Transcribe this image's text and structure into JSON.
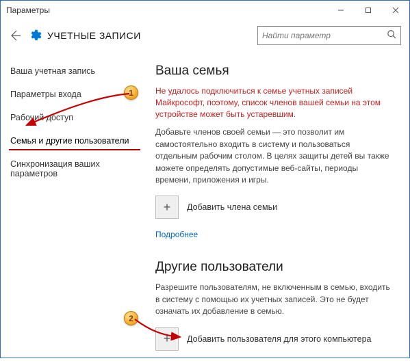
{
  "window": {
    "title": "Параметры"
  },
  "header": {
    "section_title": "УЧЕТНЫЕ ЗАПИСИ",
    "search_placeholder": "Найти параметр"
  },
  "sidebar": {
    "items": [
      {
        "label": "Ваша учетная запись"
      },
      {
        "label": "Параметры входа"
      },
      {
        "label": "Рабочий доступ"
      },
      {
        "label": "Семья и другие пользователи"
      },
      {
        "label": "Синхронизация ваших параметров"
      }
    ],
    "active_index": 3
  },
  "main": {
    "family": {
      "heading": "Ваша семья",
      "error": "Не удалось подключиться к семье учетных записей Майкрософт, поэтому, список членов вашей семьи на этом устройстве может быть устаревшим.",
      "desc": "Добавьте членов своей семьи — это позволит им самостоятельно входить в систему и пользоваться отдельным рабочим столом. В целях защиты детей вы также можете определять допустимые веб-сайты, периоды времени, приложения и игры.",
      "add_label": "Добавить члена семьи",
      "more_link": "Подробнее"
    },
    "other": {
      "heading": "Другие пользователи",
      "desc": "Разрешите пользователям, не включенным в семью, входить в систему с помощью их учетных записей. Это не будет означать их добавление в семью.",
      "add_label": "Добавить пользователя для этого компьютера"
    }
  },
  "annotations": {
    "badge1": "1",
    "badge2": "2"
  }
}
